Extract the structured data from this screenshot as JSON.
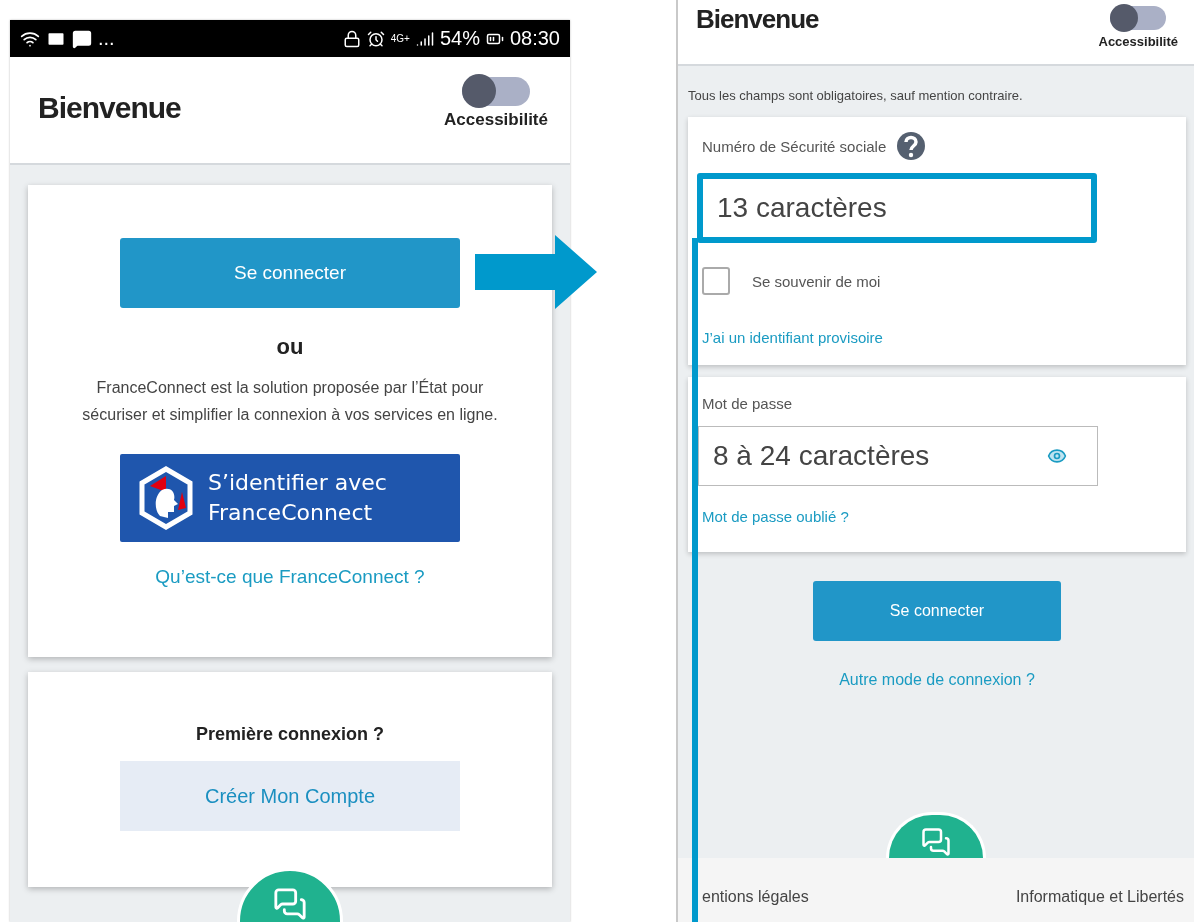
{
  "left_screen": {
    "status_bar": {
      "more": "...",
      "network": "4G+",
      "battery": "54%",
      "time": "08:30"
    },
    "header": {
      "title": "Bienvenue",
      "toggle": {
        "label": "Accessibilité",
        "on": false
      }
    },
    "login_card": {
      "button": "Se connecter",
      "separator": "ou",
      "description": "FranceConnect est la solution proposée par l’État pour sécuriser et simplifier la connexion à vos services en ligne.",
      "franceconnect_button": {
        "line_1": "S’identifier avec",
        "line_2": "FranceConnect"
      },
      "link": "Qu’est-ce que FranceConnect ?"
    },
    "first_login_card": {
      "title": "Première connexion ?",
      "button": "Créer Mon Compte"
    }
  },
  "right_screen": {
    "header": {
      "title": "Bienvenue",
      "toggle": {
        "label": "Accessibilité",
        "on": false
      }
    },
    "notice": "Tous les champs sont obligatoires, sauf mention contraire.",
    "ssn_field": {
      "label": "Numéro de Sécurité sociale",
      "placeholder": "13 caractères",
      "highlighted": true
    },
    "remember_me": {
      "label": "Se souvenir de moi",
      "checked": false
    },
    "temp_id_link": "J’ai un identifiant provisoire",
    "password_field": {
      "label": "Mot de passe",
      "placeholder": "8 à 24 caractères",
      "highlighted": false
    },
    "forgot_link": "Mot de passe oublié ?",
    "button": "Se connecter",
    "other_link": "Autre mode de connexion ?",
    "footer": {
      "left": "entions légales",
      "right": "Informatique et Libertés"
    }
  }
}
